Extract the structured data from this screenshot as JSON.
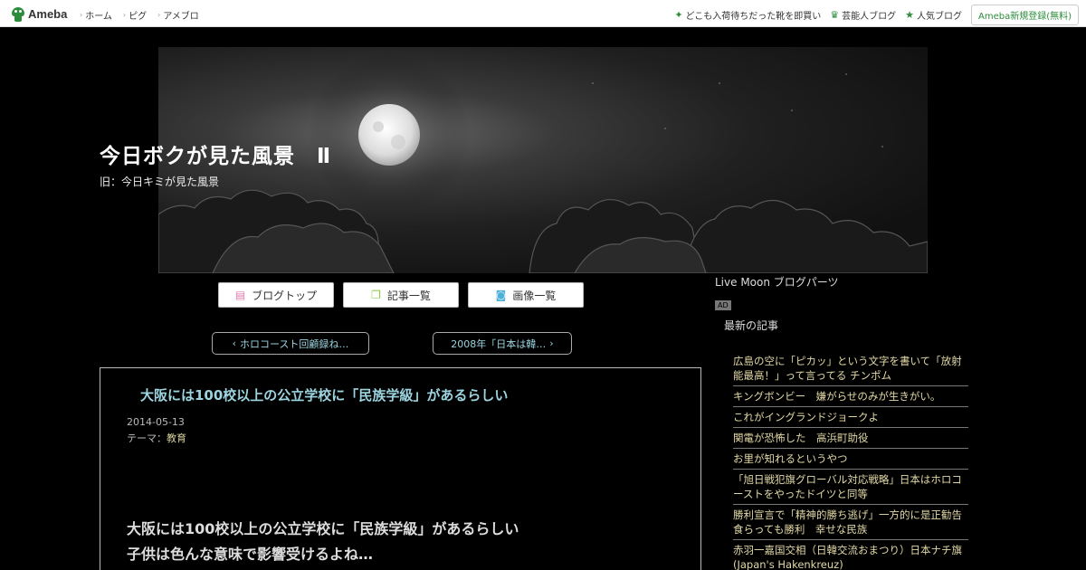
{
  "topbar": {
    "logo_text": "Ameba",
    "nav": [
      "ホーム",
      "ピグ",
      "アメブロ"
    ],
    "links": [
      "どこも入荷待ちだった靴を即買い",
      "芸能人ブログ",
      "人気ブログ"
    ],
    "register_label": "Ameba新規登録(無料)"
  },
  "blog": {
    "title": "今日ボクが見た風景　Ⅱ",
    "subtitle": "旧：今日キミが見た風景"
  },
  "tabs": [
    "ブログトップ",
    "記事一覧",
    "画像一覧"
  ],
  "pager": {
    "prev": "ホロコースト回顧録ね…",
    "next": "2008年「日本は韓…"
  },
  "article": {
    "title": "大阪には100校以上の公立学校に「民族学級」があるらしい",
    "date": "2014-05-13",
    "theme_label": "テーマ：",
    "theme": "教育",
    "body_line1": "大阪には100校以上の公立学校に「民族学級」があるらしい",
    "body_line2": "子供は色んな意味で影響受けるよね…"
  },
  "sidebar": {
    "parts_title": "Live Moon ブログパーツ",
    "ad_label": "AD",
    "recent_heading": "最新の記事",
    "recent": [
      "広島の空に「ピカッ」という文字を書いて「放射能最高！」って言ってる チンポム",
      "キングボンビー　嫌がらせのみが生きがい。",
      "これがイングランドジョークよ",
      "関電が恐怖した　高浜町助役",
      "お里が知れるというやつ",
      "「旭日戦犯旗グローバル対応戦略」日本はホロコーストをやったドイツと同等",
      "勝利宣言で「精神的勝ち逃げ」一方的に是正勧告食らっても勝利　幸せな民族",
      "赤羽一嘉国交相（日韓交流おまつり）日本ナチ旗(Japan's Hakenkreuz)"
    ]
  },
  "colors": {
    "accent_green": "#2d8c3c",
    "link_blue": "#9cd4e0",
    "sidebar_text": "#e2d9a6"
  }
}
